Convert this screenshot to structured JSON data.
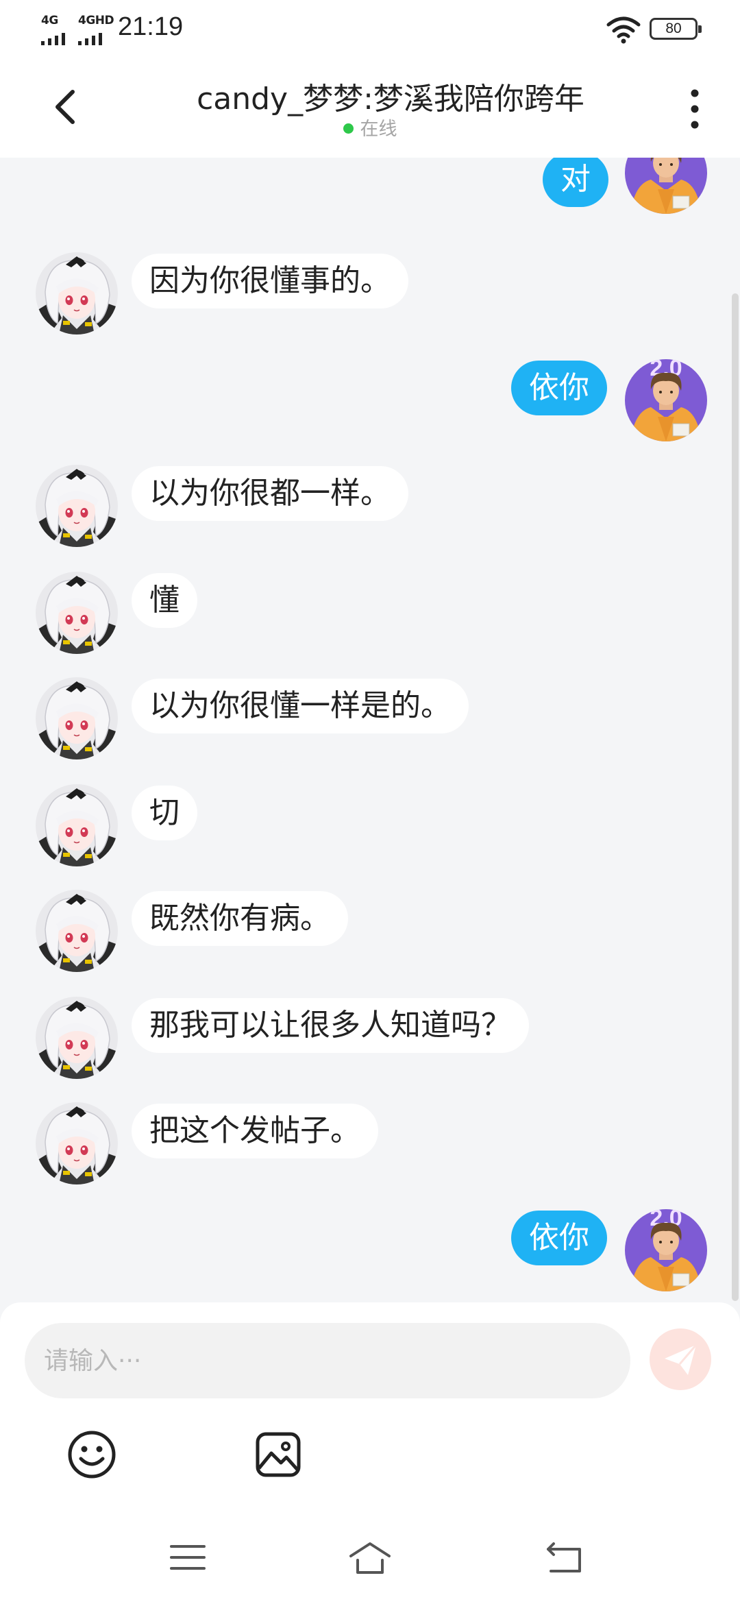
{
  "status_bar": {
    "network_1": "4G",
    "network_2": "4GHD",
    "time": "21:19",
    "battery": "80",
    "icons": [
      "signal-icon",
      "wifi-icon",
      "battery-icon"
    ]
  },
  "header": {
    "title": "candy_梦梦:梦溪我陪你跨年",
    "presence": "在线",
    "presence_color": "#2ec84a",
    "icons": [
      "back-arrow-icon",
      "more-vertical-icon"
    ]
  },
  "messages": [
    {
      "from": "me",
      "text": "对"
    },
    {
      "from": "other",
      "text": "因为你很懂事的。"
    },
    {
      "from": "me",
      "text": "依你"
    },
    {
      "from": "other",
      "text": "以为你很都一样。"
    },
    {
      "from": "other",
      "text": "懂"
    },
    {
      "from": "other",
      "text": "以为你很懂一样是的。"
    },
    {
      "from": "other",
      "text": "切"
    },
    {
      "from": "other",
      "text": "既然你有病。"
    },
    {
      "from": "other",
      "text": "那我可以让很多人知道吗？"
    },
    {
      "from": "other",
      "text": "把这个发帖子。"
    },
    {
      "from": "me",
      "text": "依你"
    }
  ],
  "input": {
    "placeholder": "请输入···",
    "value": ""
  },
  "toolbar": {
    "icons": [
      "send-icon",
      "emoji-icon",
      "image-icon"
    ]
  },
  "nav_bar": {
    "icons": [
      "menu-icon",
      "home-icon",
      "back-icon"
    ]
  },
  "colors": {
    "accent_bubble": "#1fb2f4",
    "incoming_bubble": "#ffffff",
    "chat_background": "#f4f5f7",
    "send_button": "#fde3de"
  }
}
